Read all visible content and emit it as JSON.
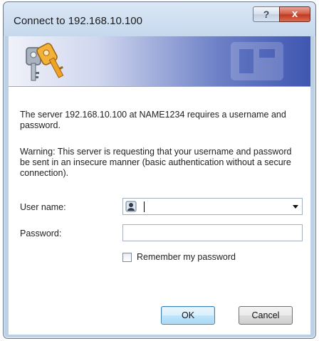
{
  "window": {
    "title": "Connect to 192.168.10.100",
    "help_label": "?",
    "close_label": "x"
  },
  "banner": {
    "icon": "keys-icon"
  },
  "message": {
    "line1": "The server 192.168.10.100 at NAME1234 requires a username and password.",
    "warning": "Warning: This server is requesting that your username and password be sent in an insecure manner (basic authentication without a secure connection)."
  },
  "form": {
    "username_label": "User name:",
    "username_value": "",
    "password_label": "Password:",
    "password_value": "",
    "remember_label": "Remember my password",
    "remember_checked": false
  },
  "buttons": {
    "ok_label": "OK",
    "cancel_label": "Cancel"
  },
  "colors": {
    "banner_accent": "#3f56b1",
    "close_button": "#c13a22",
    "ok_button_border": "#3c7fb1"
  }
}
